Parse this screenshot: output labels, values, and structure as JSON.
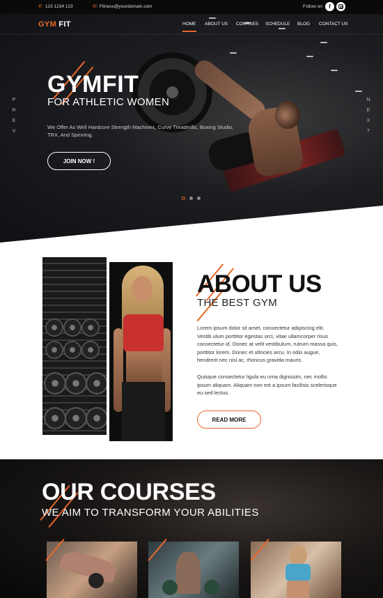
{
  "topbar": {
    "phone": "123 1234 123",
    "email": "Fitness@yourdomain.com",
    "follow_label": "Follow on",
    "social": [
      "facebook-icon",
      "instagram-icon"
    ]
  },
  "nav": {
    "logo_gym": "GYM",
    "logo_fit": "FIT",
    "items": [
      "HOME",
      "ABOUT US",
      "COURSES",
      "SCHEDULE",
      "BLOG",
      "CONTACT US"
    ],
    "active": "HOME"
  },
  "hero": {
    "title": "GYMFIT",
    "subtitle": "FOR ATHLETIC WOMEN",
    "description": "We Offer As Well Hardcore Strength Machines, Curve Treadmills, Boxing Studio, TRX, And Spinning.",
    "cta": "JOIN NOW !",
    "prev_label": "PREV",
    "next_label": "NEXT",
    "slide_count": 3,
    "active_slide": 1
  },
  "about": {
    "title": "ABOUT US",
    "subtitle": "THE BEST GYM",
    "paragraph1": "Lorem ipsum dolor sit amet, consectetur adipiscing elit. Vestib ulum porttitor egestas orci, vitae ullamcorper risus consectetur id. Donec at velit vestibulum, rutrum massa quis, porttitor lorem. Donec et ultricies arcu. In odio augue, hendrerit nec nisl ac, rhoncus gravida mauris.",
    "paragraph2": "Quisque consectetur ligula eu urna dignissim, nec mollis ipsum aliquam. Aliquam non est a ipsum facilisis scelerisque eu sed lectus.",
    "cta": "READ MORE"
  },
  "courses": {
    "title": "OUR COURSES",
    "subtitle": "WE AIM TO TRANSFORM YOUR ABILITIES"
  },
  "colors": {
    "accent": "#e8682a",
    "dark": "#0a0a0a"
  }
}
